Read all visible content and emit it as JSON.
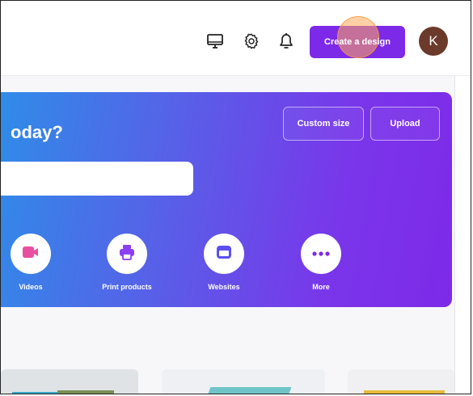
{
  "topbar": {
    "create_label": "Create a design",
    "avatar_initial": "K",
    "icons": [
      "desktop-icon",
      "gear-icon",
      "bell-icon"
    ]
  },
  "hero": {
    "title": "oday?",
    "custom_size_label": "Custom size",
    "upload_label": "Upload",
    "search_placeholder": ""
  },
  "categories": [
    {
      "label": "Videos",
      "icon": "video-icon",
      "color": "#e94fa0"
    },
    {
      "label": "Print products",
      "icon": "printer-icon",
      "color": "#8b3ff0"
    },
    {
      "label": "Websites",
      "icon": "website-icon",
      "color": "#5b4ff0"
    },
    {
      "label": "More",
      "icon": "more-icon",
      "color": "#7d2ae8"
    }
  ],
  "colors": {
    "accent": "#7d2ae8",
    "gradient_start": "#2f8ce8",
    "gradient_end": "#7d2ae8",
    "avatar": "#6b3a2a"
  }
}
